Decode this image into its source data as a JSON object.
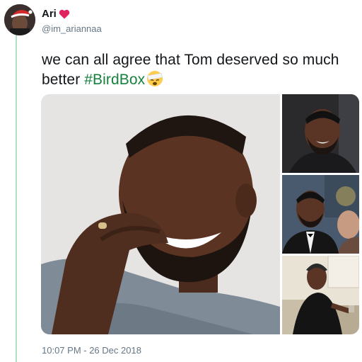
{
  "author": {
    "display_name": "Ari",
    "handle": "@im_ariannaa",
    "avatar_icon": "profile-photo-santa-hat",
    "name_emoji": "red-heart-icon"
  },
  "tweet": {
    "text_before_hashtag": "we can all agree that Tom deserved so much better ",
    "hashtag": "#BirdBox",
    "trailing_emoji": "face-with-bandage-icon",
    "timestamp": "10:07 PM - 26 Dec 2018"
  },
  "media": {
    "count": 4,
    "items": [
      {
        "subject": "smiling bearded man, grey knit sweater"
      },
      {
        "subject": "smiling man, dark background"
      },
      {
        "subject": "man in tuxedo at event"
      },
      {
        "subject": "man in black t-shirt, kitchen"
      }
    ]
  },
  "colors": {
    "hashtag": "#17803d",
    "thread_line": "#b1e0c6",
    "muted_text": "#657786",
    "heart": "#e0245e"
  }
}
